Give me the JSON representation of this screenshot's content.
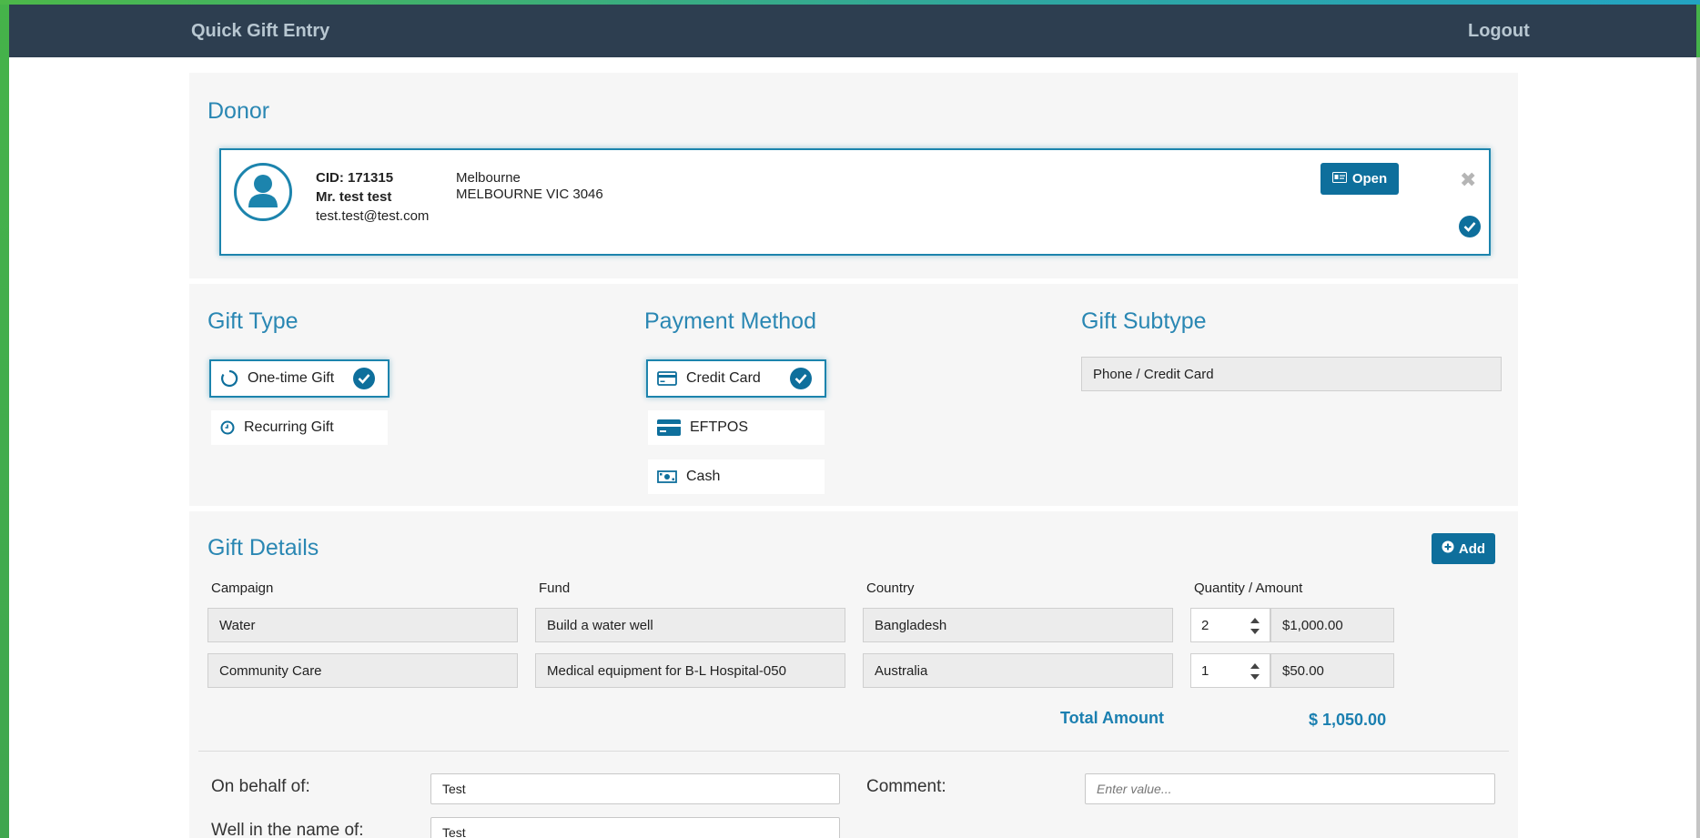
{
  "nav": {
    "title": "Quick Gift Entry",
    "logout": "Logout"
  },
  "donor": {
    "section_title": "Donor",
    "cid": "CID: 171315",
    "name": "Mr. test test",
    "email": "test.test@test.com",
    "city": "Melbourne",
    "address": "MELBOURNE VIC 3046",
    "open_label": "Open"
  },
  "gift_type": {
    "section_title": "Gift Type",
    "options": [
      {
        "label": "One-time Gift",
        "selected": true
      },
      {
        "label": "Recurring Gift",
        "selected": false
      }
    ]
  },
  "payment_method": {
    "section_title": "Payment Method",
    "options": [
      {
        "label": "Credit Card",
        "selected": true
      },
      {
        "label": "EFTPOS",
        "selected": false
      },
      {
        "label": "Cash",
        "selected": false
      }
    ]
  },
  "gift_subtype": {
    "section_title": "Gift Subtype",
    "value": "Phone / Credit Card"
  },
  "gift_details": {
    "section_title": "Gift Details",
    "add_label": "Add",
    "columns": [
      "Campaign",
      "Fund",
      "Country",
      "Quantity / Amount"
    ],
    "rows": [
      {
        "campaign": "Water",
        "fund": "Build a water well",
        "country": "Bangladesh",
        "quantity": "2",
        "amount": "$1,000.00"
      },
      {
        "campaign": "Community Care",
        "fund": "Medical equipment for B-L Hospital-050",
        "country": "Australia",
        "quantity": "1",
        "amount": "$50.00"
      }
    ],
    "total_label": "Total Amount",
    "total_value": "$ 1,050.00"
  },
  "extra": {
    "on_behalf_label": "On behalf of:",
    "on_behalf_value": "Test",
    "comment_label": "Comment:",
    "comment_placeholder": "Enter value...",
    "well_name_label": "Well in the name of:",
    "well_name_value": "Test"
  },
  "colors": {
    "accent": "#1c84ad",
    "button": "#0e6f9c",
    "navbar": "#2d3e50",
    "title": "#2a87b3"
  }
}
